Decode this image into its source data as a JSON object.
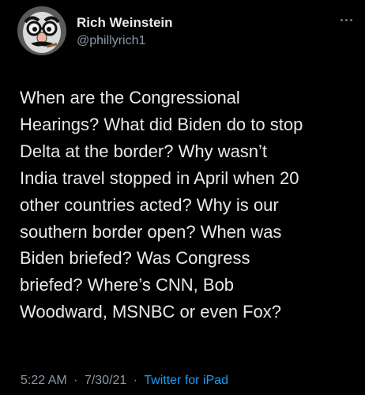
{
  "author": {
    "display_name": "Rich Weinstein",
    "handle": "@phillyrich1",
    "avatar_icon": "groucho-glasses-avatar"
  },
  "tweet": {
    "lines": [
      "When are the Congressional",
      "Hearings? What did Biden do to stop",
      "Delta at the border? Why wasn’t",
      "India travel stopped in April when 20",
      "other countries acted? Why is our",
      "southern border open? When was",
      "Biden briefed? Was Congress",
      "briefed? Where’s CNN, Bob",
      "Woodward, MSNBC or even Fox?"
    ]
  },
  "meta": {
    "time": "5:22 AM",
    "separator_1": "·",
    "date": "7/30/21",
    "separator_2": "·",
    "source": "Twitter for iPad"
  },
  "colors": {
    "background": "#000000",
    "text": "#e7e9ea",
    "secondary": "#8b98a5",
    "link": "#1d9bf0"
  },
  "icons": {
    "more": "more-dots-icon"
  }
}
